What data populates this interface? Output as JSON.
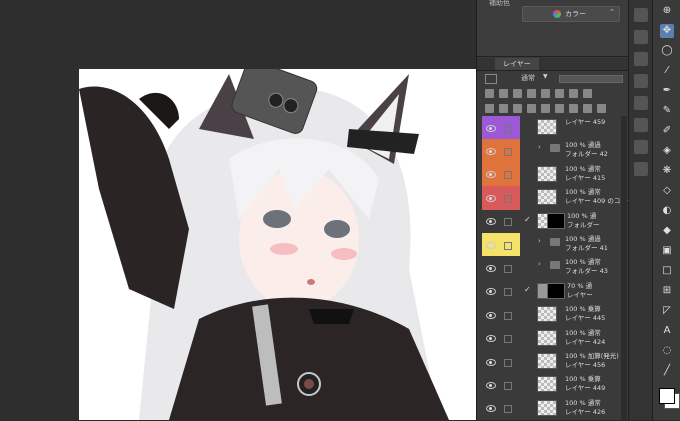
{
  "properties": {
    "label": "補助色",
    "color_mode": "カラー"
  },
  "layer_panel": {
    "tab_label": "レイヤー",
    "blend_mode": "通常"
  },
  "layers": [
    {
      "name": "レイヤー 459",
      "mode": "",
      "type": "layer",
      "color": "#9b59d6",
      "pair": true
    },
    {
      "name": "フォルダー 42",
      "mode": "100 % 通過",
      "type": "folder",
      "color": "#e0733c"
    },
    {
      "name": "レイヤー 415",
      "mode": "100 % 通常",
      "type": "layer",
      "color": "#e0733c"
    },
    {
      "name": "レイヤー 409 のコピー",
      "mode": "100 % 通常",
      "type": "layer",
      "color": "#d95a5a"
    },
    {
      "name": "フォルダー",
      "mode": "100 % 通",
      "type": "masked-folder",
      "color": ""
    },
    {
      "name": "フォルダー 41",
      "mode": "100 % 通過",
      "type": "folder",
      "color": "#f5e26a"
    },
    {
      "name": "フォルダー 43",
      "mode": "100 % 通常",
      "type": "folder",
      "color": ""
    },
    {
      "name": "レイヤー",
      "mode": "70 % 通",
      "type": "masked-layer",
      "color": ""
    },
    {
      "name": "レイヤー 445",
      "mode": "100 % 乗算",
      "type": "layer",
      "color": ""
    },
    {
      "name": "レイヤー 424",
      "mode": "100 % 通常",
      "type": "layer",
      "color": ""
    },
    {
      "name": "レイヤー 456",
      "mode": "100 % 加算(発光)",
      "type": "layer",
      "color": ""
    },
    {
      "name": "レイヤー 449",
      "mode": "100 % 乗算",
      "type": "layer",
      "color": ""
    },
    {
      "name": "レイヤー 426",
      "mode": "100 % 通常",
      "type": "layer",
      "color": ""
    }
  ]
}
